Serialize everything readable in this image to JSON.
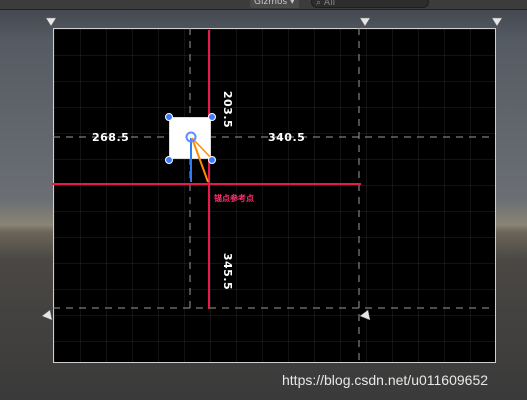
{
  "toolbar": {
    "gizmos_label": "Gizmos ▾",
    "search_placeholder": "All"
  },
  "dimensions": {
    "left": "268.5",
    "right": "340.5",
    "top": "203.5",
    "bottom": "345.5"
  },
  "anchor_label": "锚点参考点",
  "watermark": "https://blog.csdn.net/u011609652",
  "colors": {
    "anchor_line": "#e8194b",
    "guide_dashed": "#9a9a9a",
    "canvas": "#000000",
    "handle": "#3d7bff",
    "pivot": "#5c8cff",
    "y_axis": "#2f7df6",
    "x_axis": "#ff8c00"
  }
}
